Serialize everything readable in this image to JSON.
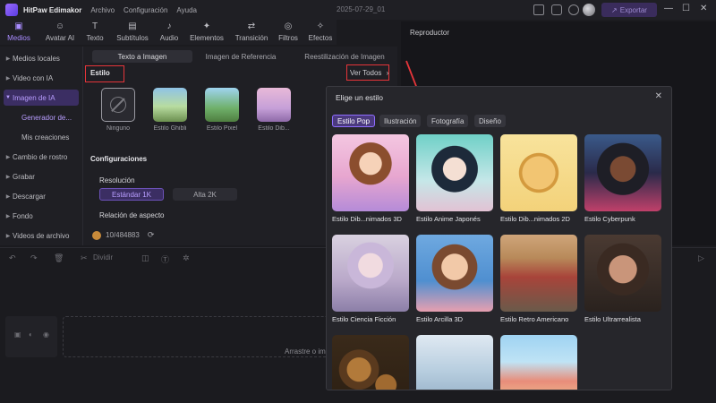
{
  "app": {
    "name": "HitPaw Edimakor",
    "menu": [
      "Archivo",
      "Configuración",
      "Ayuda"
    ],
    "date": "2025-07-29_01",
    "export_label": "Exportar"
  },
  "toolbar": {
    "items": [
      {
        "label": "Medios",
        "icon": "media-icon"
      },
      {
        "label": "Avatar AI",
        "icon": "avatar-icon"
      },
      {
        "label": "Texto",
        "icon": "text-icon"
      },
      {
        "label": "Subtítulos",
        "icon": "subtitles-icon"
      },
      {
        "label": "Audio",
        "icon": "audio-icon"
      },
      {
        "label": "Elementos",
        "icon": "elements-icon"
      },
      {
        "label": "Transición",
        "icon": "transition-icon"
      },
      {
        "label": "Filtros",
        "icon": "filters-icon"
      },
      {
        "label": "Efectos",
        "icon": "effects-icon"
      }
    ]
  },
  "sidebar": {
    "items": [
      {
        "label": "Medios locales"
      },
      {
        "label": "Video con IA"
      },
      {
        "label": "Imagen de IA"
      },
      {
        "label": "Generador de..."
      },
      {
        "label": "Mis creaciones"
      },
      {
        "label": "Cambio de rostro"
      },
      {
        "label": "Grabar"
      },
      {
        "label": "Descargar"
      },
      {
        "label": "Fondo"
      },
      {
        "label": "Videos de archivo"
      }
    ]
  },
  "center": {
    "tabs": [
      "Texto a Imagen",
      "Imagen de Referencia",
      "Reestilización de Imagen"
    ],
    "style_section": "Estilo",
    "view_all": "Ver Todos",
    "styles": [
      "Ninguno",
      "Estilo Ghibli",
      "Estilo Pixel",
      "Estilo Dib..."
    ],
    "config_label": "Configuraciones",
    "resolution_label": "Resolución",
    "resolution_options": [
      "Estándar 1K",
      "Alta 2K"
    ],
    "aspect_label": "Relación de aspecto",
    "credits": "10/484883"
  },
  "player": {
    "title": "Reproductor"
  },
  "timeline": {
    "split_label": "Dividir",
    "drop_hint": "Arrastre o im"
  },
  "modal": {
    "title": "Elige un estilo",
    "filters": [
      "Estilo Pop",
      "Ilustración",
      "Fotografía",
      "Diseño"
    ],
    "cards": [
      {
        "caption": "Estilo Dib...nimados 3D"
      },
      {
        "caption": "Estilo Anime Japonés"
      },
      {
        "caption": "Estilo Dib...nimados 2D"
      },
      {
        "caption": "Estilo Cyberpunk"
      },
      {
        "caption": "Estilo Ciencia Ficción"
      },
      {
        "caption": "Estilo Arcilla 3D"
      },
      {
        "caption": "Estilo Retro Americano"
      },
      {
        "caption": "Estilo Ultrarrealista"
      },
      {
        "caption": ""
      },
      {
        "caption": ""
      },
      {
        "caption": ""
      }
    ]
  },
  "colors": {
    "accent": "#8f6dff",
    "highlight": "#e6353a",
    "background": "#1b1b1f"
  }
}
